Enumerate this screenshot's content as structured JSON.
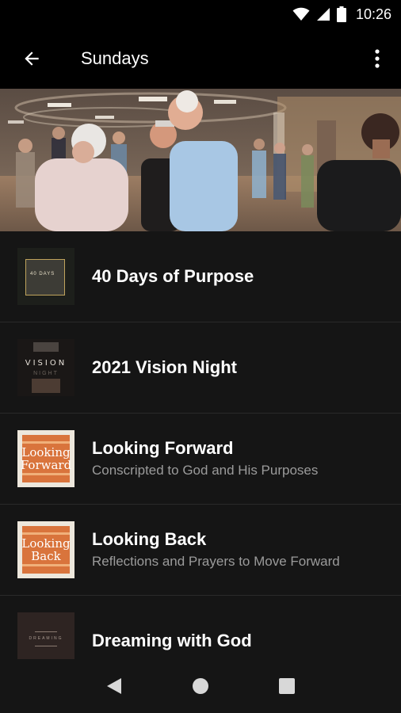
{
  "status_bar": {
    "time": "10:26",
    "icons": [
      "wifi-icon",
      "signal-icon",
      "battery-icon"
    ]
  },
  "app_bar": {
    "title": "Sundays",
    "back_icon": "arrow-left-icon",
    "menu_icon": "more-vertical-icon"
  },
  "hero": {
    "description_icon": "church-lobby-photo"
  },
  "items": [
    {
      "title": "40 Days of Purpose",
      "subtitle": "",
      "thumb_label": "40 DAYS"
    },
    {
      "title": "2021 Vision Night",
      "subtitle": "",
      "thumb_label": "VISION",
      "thumb_sublabel": "NIGHT"
    },
    {
      "title": "Looking Forward",
      "subtitle": "Conscripted to God and His Purposes",
      "thumb_label": "Looking Forward"
    },
    {
      "title": "Looking Back",
      "subtitle": "Reflections and Prayers to Move Forward",
      "thumb_label": "Looking Back"
    },
    {
      "title": "Dreaming with God",
      "subtitle": "",
      "thumb_label": "DREAMING"
    }
  ],
  "nav_bar": {
    "icons": [
      "back-triangle-icon",
      "home-circle-icon",
      "recents-square-icon"
    ]
  },
  "colors": {
    "background": "#151515",
    "bar": "#000000",
    "divider": "#2a2a2a",
    "subtitle": "#9b9b9b",
    "accent_orange": "#d9743c"
  }
}
